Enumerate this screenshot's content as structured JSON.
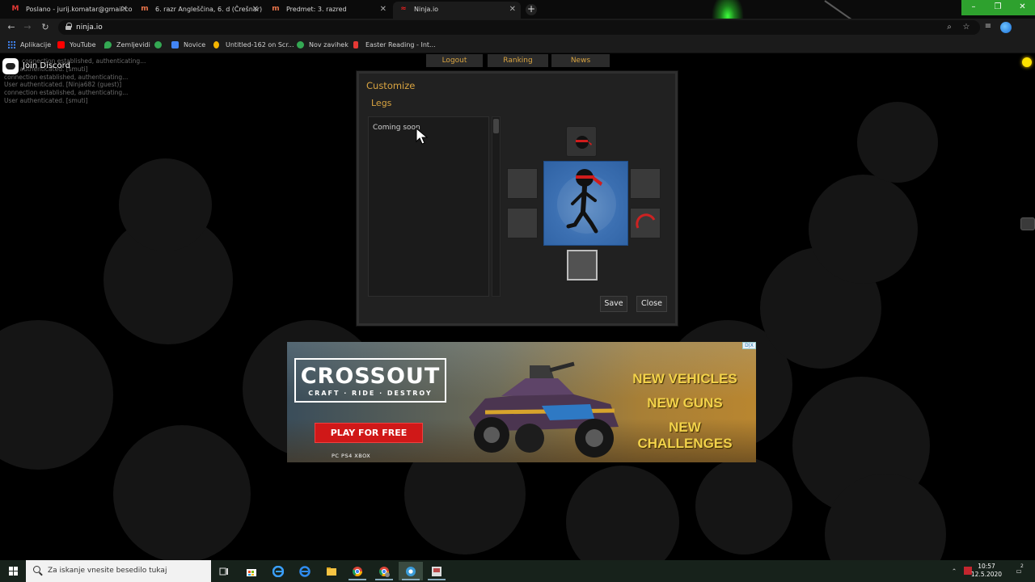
{
  "browser": {
    "tabs": [
      {
        "title": "Poslano - jurij.komatar@gmail.co",
        "icon": "gmail-icon"
      },
      {
        "title": "6. razr Angleščina, 6. d (Črešnar)",
        "icon": "teams-icon"
      },
      {
        "title": "Predmet: 3. razred",
        "icon": "teams-icon"
      },
      {
        "title": "Ninja.io",
        "icon": "ninja-icon"
      }
    ],
    "url": "ninja.io",
    "bookmarks": [
      {
        "label": "Aplikacije",
        "color": "#4285f4"
      },
      {
        "label": "YouTube",
        "color": "#ff0000"
      },
      {
        "label": "Zemljevidi",
        "color": "#34a853"
      },
      {
        "label": "",
        "color": "#34a853"
      },
      {
        "label": "Novice",
        "color": "#4285f4"
      },
      {
        "label": "Untitled-162 on Scr...",
        "color": "#f4b400"
      },
      {
        "label": "Nov zavihek",
        "color": "#34a853"
      },
      {
        "label": "Easter Reading - Int...",
        "color": "#e53935"
      }
    ]
  },
  "game": {
    "menu": [
      "Logout",
      "Ranking",
      "News"
    ],
    "discord_label": "Join Discord",
    "console_lines": [
      "connection established, authenticating...",
      "User authenticated. [smuti]",
      "connection established, authenticating...",
      "User authenticated. [Ninja682 (guest)]",
      "connection established, authenticating...",
      "User authenticated. [smuti]"
    ],
    "customize": {
      "title": "Customize",
      "category": "Legs",
      "list_text": "Coming soon",
      "save_label": "Save",
      "close_label": "Close"
    },
    "accent_color": "#d9a441"
  },
  "ad": {
    "brand": "CROSSOUT",
    "tagline": "CRAFT · RIDE · DESTROY",
    "cta": "PLAY FOR FREE",
    "platforms": "PC   PS4   XBOX",
    "pitch": [
      "NEW VEHICLES",
      "NEW GUNS",
      "NEW CHALLENGES"
    ],
    "adchoices": "D|X"
  },
  "taskbar": {
    "search_placeholder": "Za iskanje vnesite besedilo tukaj",
    "time": "10:57",
    "date": "12.5.2020",
    "notification_count": "2"
  }
}
